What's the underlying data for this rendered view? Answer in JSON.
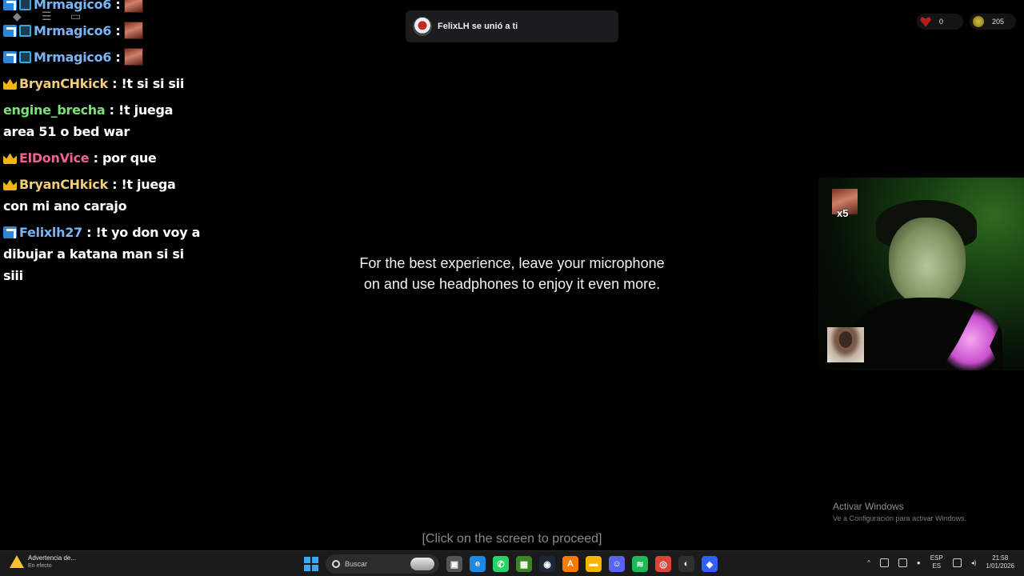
{
  "chat": {
    "messages": [
      {
        "badges": [
          "prime",
          "kick"
        ],
        "user": "Mrmagico6",
        "user_color": "#7ab4f4",
        "sep": " :",
        "text": "",
        "emote": true
      },
      {
        "badges": [
          "prime",
          "kick"
        ],
        "user": "Mrmagico6",
        "user_color": "#7ab4f4",
        "sep": " :",
        "text": "",
        "emote": true
      },
      {
        "badges": [
          "prime",
          "kick"
        ],
        "user": "Mrmagico6",
        "user_color": "#7ab4f4",
        "sep": " :",
        "text": "",
        "emote": true
      },
      {
        "badges": [
          "crown"
        ],
        "user": "BryanCHkick",
        "user_color": "#f2cd7a",
        "sep": " : ",
        "text": "!t si si sii",
        "emote": false
      },
      {
        "badges": [],
        "user": "engine_brecha",
        "user_color": "#7ee07a",
        "sep": " : ",
        "text": "!t juega area 51 o bed war",
        "emote": false
      },
      {
        "badges": [
          "crown"
        ],
        "user": "ElDonVice",
        "user_color": "#f06292",
        "sep": " : ",
        "text": "por que",
        "emote": false
      },
      {
        "badges": [
          "crown"
        ],
        "user": "BryanCHkick",
        "user_color": "#f2cd7a",
        "sep": " : ",
        "text": "!t juega con mi ano carajo",
        "emote": false
      },
      {
        "badges": [
          "prime"
        ],
        "user": "Felixlh27",
        "user_color": "#7ab4f4",
        "sep": " : ",
        "text": "!t yo don voy a dibujar a katana man si si siii",
        "emote": false
      }
    ]
  },
  "topbar": {
    "icons": [
      "roblox-logo-icon",
      "menu-icon",
      "chat-bubble-icon"
    ]
  },
  "toast": {
    "text": "FelixLH se unió a ti",
    "icon": "avatar-icon"
  },
  "currency": {
    "hearts": "0",
    "coins": "205"
  },
  "game": {
    "message": "For the best experience, leave your microphone on and use headphones to enjoy it even more.",
    "proceed": "[Click on the screen to proceed]"
  },
  "webcam": {
    "emote_count": "x5"
  },
  "watermark": {
    "title": "Activar Windows",
    "subtitle": "Ve a Configuración para activar Windows."
  },
  "taskbar": {
    "notification_title": "Advertencia de...",
    "notification_sub": "En efecto",
    "search_placeholder": "Buscar",
    "apps": [
      {
        "name": "task-view-icon",
        "color": "#555555",
        "glyph": "▣"
      },
      {
        "name": "edge-icon",
        "color": "#1e88e5",
        "glyph": "e"
      },
      {
        "name": "whatsapp-icon",
        "color": "#25d366",
        "glyph": "✆"
      },
      {
        "name": "minecraft-icon",
        "color": "#3c8527",
        "glyph": "▦"
      },
      {
        "name": "steam-icon",
        "color": "#1b2838",
        "glyph": "◉"
      },
      {
        "name": "app-orange-icon",
        "color": "#f57c00",
        "glyph": "A"
      },
      {
        "name": "file-explorer-icon",
        "color": "#f4b400",
        "glyph": "▬"
      },
      {
        "name": "discord-icon",
        "color": "#5865f2",
        "glyph": "☺"
      },
      {
        "name": "spotify-icon",
        "color": "#1db954",
        "glyph": "≋"
      },
      {
        "name": "chrome-icon",
        "color": "#db4437",
        "glyph": "◎"
      },
      {
        "name": "obs-icon",
        "color": "#302e31",
        "glyph": "◐"
      },
      {
        "name": "roblox-studio-icon",
        "color": "#335fff",
        "glyph": "◆"
      }
    ],
    "language_top": "ESP",
    "language_bottom": "ES",
    "time": "21:58",
    "date": "1/01/2026"
  }
}
